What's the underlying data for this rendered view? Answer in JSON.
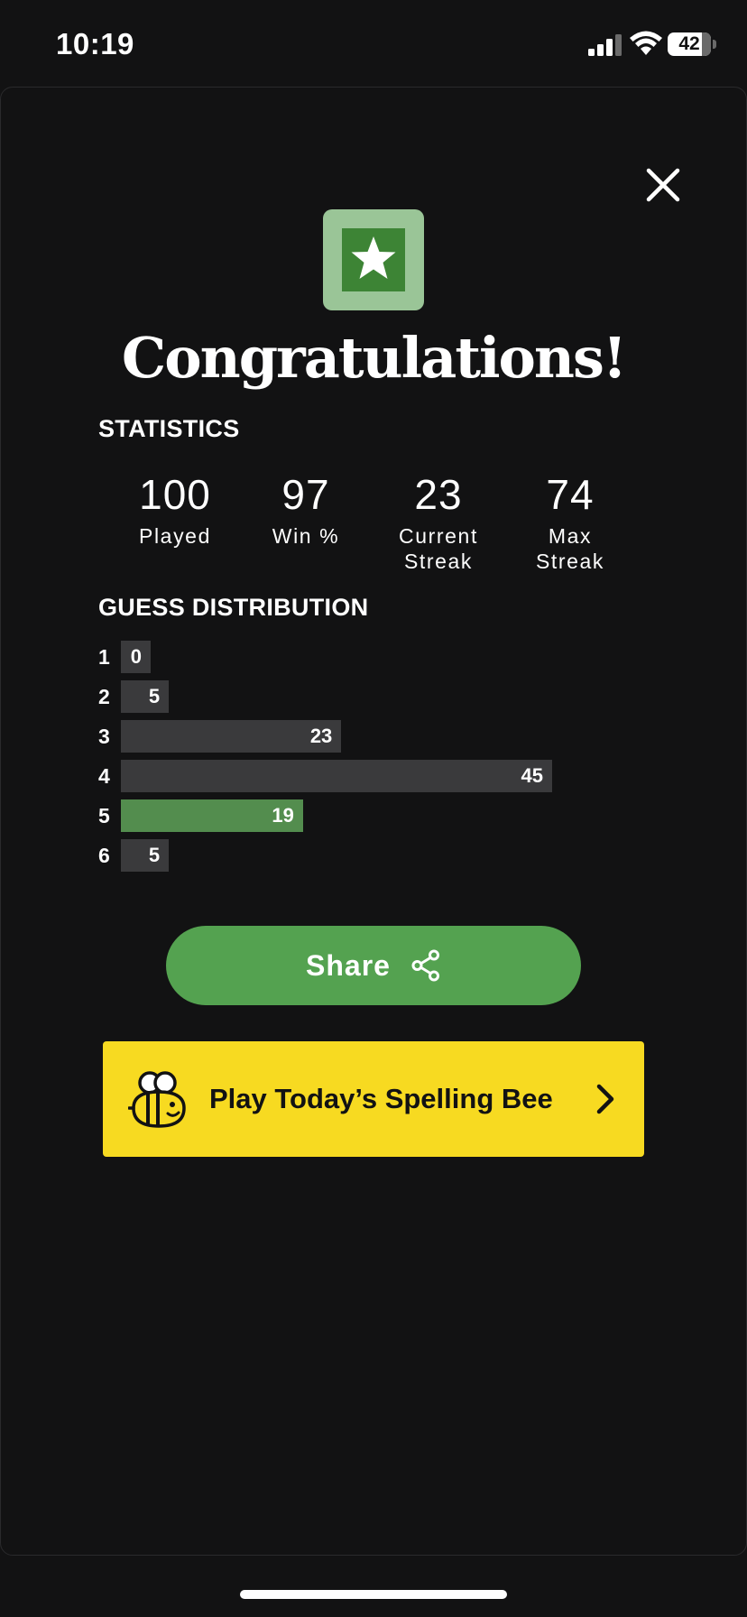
{
  "status_bar": {
    "time": "10:19",
    "battery_level": "42",
    "icons": [
      "signal-icon",
      "wifi-icon",
      "battery-icon"
    ]
  },
  "modal": {
    "close_icon": "close-icon",
    "badge_icon": "star-icon",
    "title": "Congratulations!",
    "statistics": {
      "heading": "STATISTICS",
      "items": [
        {
          "value": "100",
          "label": "Played"
        },
        {
          "value": "97",
          "label": "Win %"
        },
        {
          "value": "23",
          "label": "Current\nStreak"
        },
        {
          "value": "74",
          "label": "Max\nStreak"
        }
      ]
    },
    "distribution": {
      "heading": "GUESS DISTRIBUTION",
      "highlight_row": 5,
      "rows": [
        {
          "guess": "1",
          "count": "0"
        },
        {
          "guess": "2",
          "count": "5"
        },
        {
          "guess": "3",
          "count": "23"
        },
        {
          "guess": "4",
          "count": "45"
        },
        {
          "guess": "5",
          "count": "19"
        },
        {
          "guess": "6",
          "count": "5"
        }
      ]
    },
    "share_button": {
      "label": "Share",
      "icon": "share-icon"
    },
    "promo": {
      "label": "Play Today’s Spelling Bee",
      "icon": "bee-icon",
      "chevron": "chevron-right-icon"
    }
  },
  "colors": {
    "background": "#121213",
    "bar": "#3a3a3c",
    "bar_highlight": "#538d4e",
    "share_button": "#54a250",
    "promo_background": "#f7da21",
    "badge_outer": "#9ac597",
    "badge_inner": "#3d8435"
  }
}
